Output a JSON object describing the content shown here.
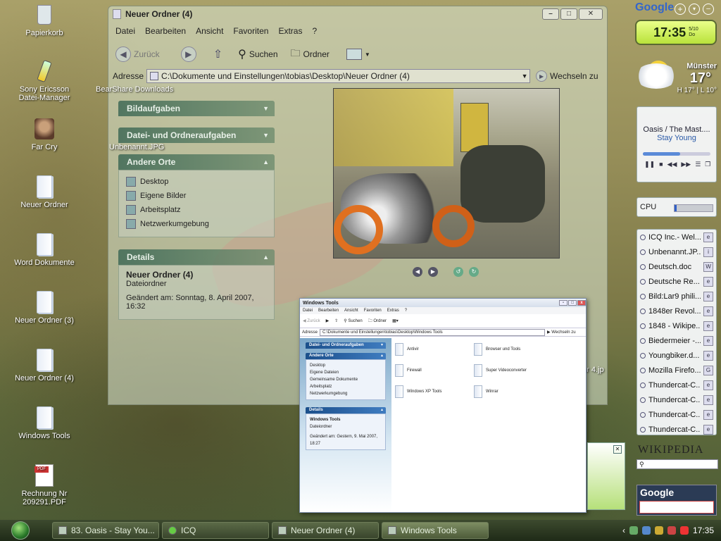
{
  "desktop": {
    "icons": [
      {
        "label": "Papierkorb"
      },
      {
        "label": "Sony Ericsson Datei-Manager"
      },
      {
        "label": "Far Cry"
      },
      {
        "label": "Neuer Ordner"
      },
      {
        "label": "Word Dokumente"
      },
      {
        "label": "Neuer Ordner (3)"
      },
      {
        "label": "Neuer Ordner (4)"
      },
      {
        "label": "Windows Tools"
      },
      {
        "label": "Rechnung Nr 209291.PDF"
      }
    ],
    "overlay_labels": {
      "bearshare": "BearShare Downloads",
      "unbenannt": "Unbenannt.JPG",
      "file_4jpg": "ur 4.jp"
    }
  },
  "main_window": {
    "title": "Neuer Ordner (4)",
    "menu": [
      "Datei",
      "Bearbeiten",
      "Ansicht",
      "Favoriten",
      "Extras",
      "?"
    ],
    "toolbar": {
      "back": "Zurück",
      "search": "Suchen",
      "folders": "Ordner"
    },
    "address_label": "Adresse",
    "address_value": "C:\\Dokumente und Einstellungen\\tobias\\Desktop\\Neuer Ordner (4)",
    "go_label": "Wechseln zu",
    "panes": {
      "bildaufgaben": "Bildaufgaben",
      "dateiaufgaben": "Datei- und Ordneraufgaben",
      "andere_orte": {
        "title": "Andere Orte",
        "items": [
          "Desktop",
          "Eigene Bilder",
          "Arbeitsplatz",
          "Netzwerkumgebung"
        ]
      },
      "details": {
        "title": "Details",
        "name": "Neuer Ordner (4)",
        "type": "Dateiordner",
        "changed": "Geändert am: Sonntag, 8. April 2007, 16:32"
      }
    }
  },
  "small_window": {
    "title": "Windows Tools",
    "menu": [
      "Datei",
      "Bearbeiten",
      "Ansicht",
      "Favoriten",
      "Extras",
      "?"
    ],
    "toolbar": {
      "back": "Zurück",
      "search": "Suchen",
      "folders": "Ordner"
    },
    "address_label": "Adresse",
    "address_value": "C:\\Dokumente und Einstellungen\\tobias\\Desktop\\Windows Tools",
    "go_label": "Wechseln zu",
    "panes": {
      "dateiaufgaben": "Datei- und Ordneraufgaben",
      "andere_orte": {
        "title": "Andere Orte",
        "items": [
          "Desktop",
          "Eigene Dateien",
          "Gemeinsame Dokumente",
          "Arbeitsplatz",
          "Netzwerkumgebung"
        ]
      },
      "details": {
        "title": "Details",
        "name": "Windows Tools",
        "type": "Dateiordner",
        "changed": "Geändert am: Gestern, 9. Mai 2007, 18:27"
      }
    },
    "folders": [
      "Antivir",
      "Browser und Tools",
      "Firewall",
      "Super Videoconverter",
      "Windows XP Tools",
      "Winrar"
    ]
  },
  "taskbar": {
    "tasks": [
      "83. Oasis - Stay You...",
      "ICQ",
      "Neuer Ordner (4)",
      "Windows Tools"
    ],
    "time": "17:35"
  },
  "sidebar": {
    "google_top": "Google",
    "clock": {
      "time": "17:35",
      "date": "5/10",
      "day": "Do"
    },
    "weather": {
      "city": "Münster",
      "temp": "17°",
      "hilo": "H 17° | L 10°"
    },
    "media": {
      "artist": "Oasis / The Mast....",
      "track": "Stay Young",
      "progress": 0.55
    },
    "cpu": {
      "label": "CPU",
      "usage": 0.05
    },
    "feed": [
      "ICQ Inc.- Wel...",
      "Unbenannt.JP...",
      "Deutsch.doc",
      "Deutsche Re...",
      "Bild:Lar9 phili...",
      "1848er Revol...",
      "1848 - Wikipe...",
      "Biedermeier -...",
      "Youngbiker.d...",
      "Mozilla Firefo...",
      "Thundercat-C...",
      "Thundercat-C...",
      "Thundercat-C...",
      "Thundercat-C..."
    ],
    "wikipedia": "WIKIPEDIA",
    "google_bottom": "Google"
  },
  "colors": {
    "accent": "#3f7cc0",
    "taskbar": "#2c3a22",
    "clock": "#c8ec4a"
  }
}
